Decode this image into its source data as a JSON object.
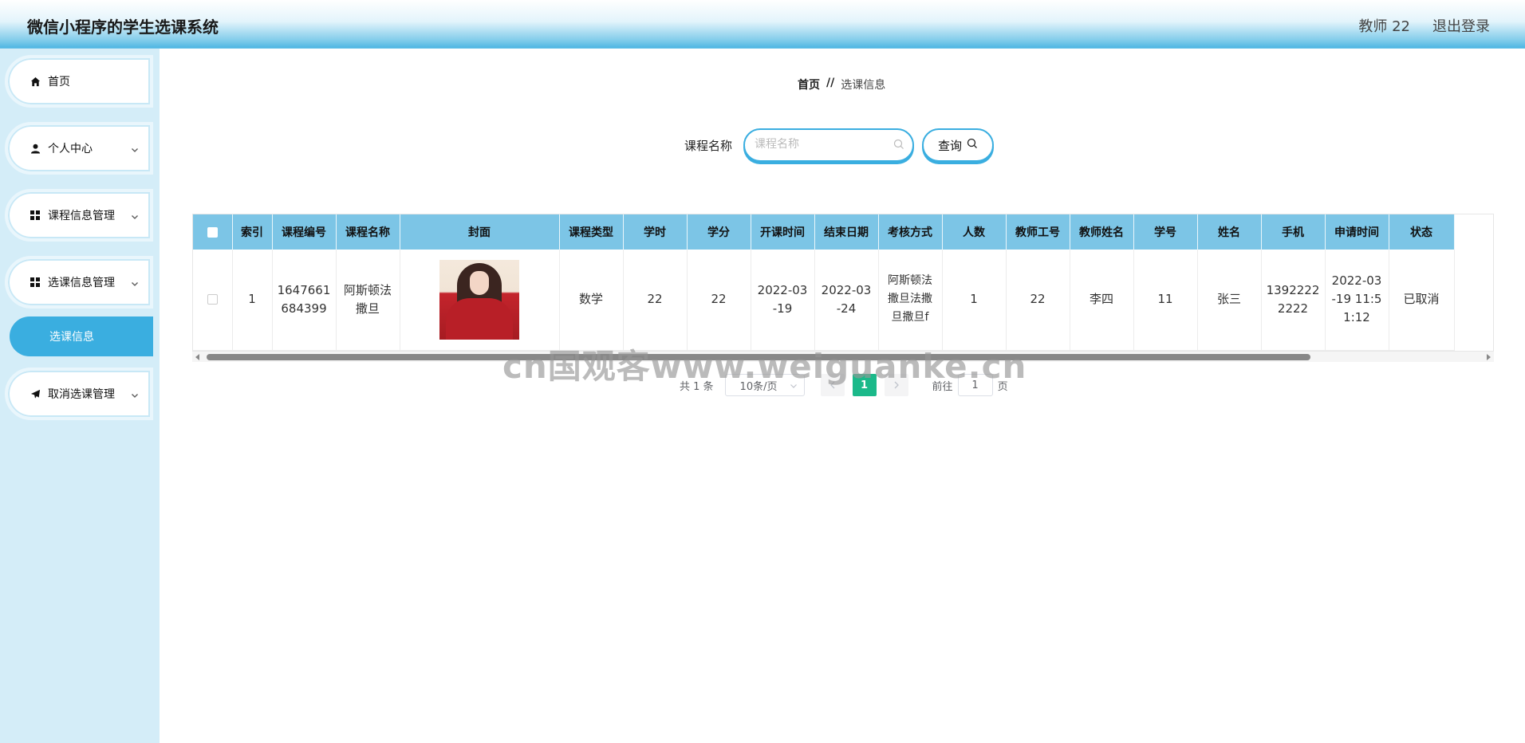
{
  "header": {
    "app_title": "微信小程序的学生选课系统",
    "user_label": "教师 22",
    "logout_label": "退出登录"
  },
  "sidebar": {
    "items": [
      {
        "label": "首页",
        "icon": "home-icon"
      },
      {
        "label": "个人中心",
        "icon": "user-icon"
      },
      {
        "label": "课程信息管理",
        "icon": "grid-icon"
      },
      {
        "label": "选课信息管理",
        "icon": "grid-icon"
      },
      {
        "label": "取消选课管理",
        "icon": "paper-plane-icon"
      }
    ],
    "active_subitem": "选课信息"
  },
  "breadcrumb": {
    "home": "首页",
    "separator": "//",
    "current": "选课信息"
  },
  "search": {
    "label": "课程名称",
    "placeholder": "课程名称",
    "value": "",
    "button_label": "查询"
  },
  "table": {
    "columns": [
      "索引",
      "课程编号",
      "课程名称",
      "封面",
      "课程类型",
      "学时",
      "学分",
      "开课时间",
      "结束日期",
      "考核方式",
      "人数",
      "教师工号",
      "教师姓名",
      "学号",
      "姓名",
      "手机",
      "申请时间",
      "状态"
    ],
    "rows": [
      {
        "index": "1",
        "course_no": "1647661684399",
        "course_name": "阿斯顿法撒旦",
        "course_type": "数学",
        "hours": "22",
        "credits": "22",
        "start_time": "2022-03-19",
        "end_date": "2022-03-24",
        "assessment": "阿斯顿法撒旦法撒旦撒旦f",
        "count": "1",
        "teacher_no": "22",
        "teacher_name": "李四",
        "student_no": "11",
        "student_name": "张三",
        "phone": "13922222222",
        "apply_time": "2022-03-19 11:51:12",
        "status": "已取消"
      }
    ]
  },
  "pagination": {
    "total_text": "共 1 条",
    "page_size": "10条/页",
    "current_page": "1",
    "goto_label": "前往",
    "goto_value": "1",
    "page_suffix": "页"
  },
  "watermark": "cn国观客www.weiguanke.cn",
  "colors": {
    "accent": "#3aaee0",
    "table_header": "#7cc5e6",
    "sidebar_bg": "#d4edf8",
    "page_active": "#1bb98a"
  }
}
